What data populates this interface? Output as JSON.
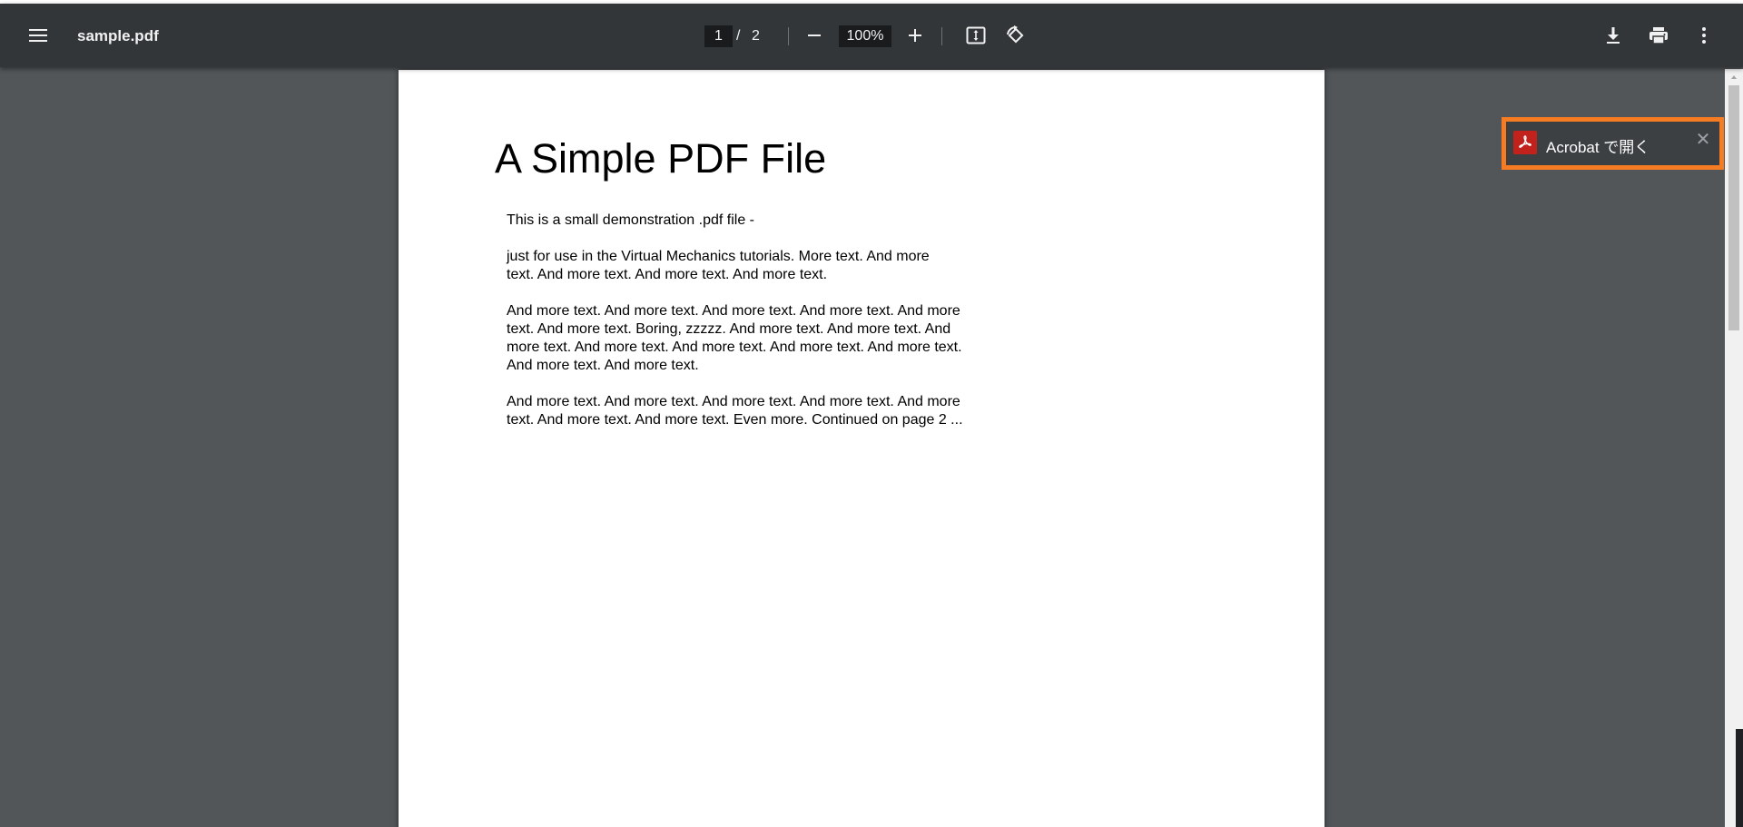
{
  "toolbar": {
    "title": "sample.pdf",
    "current_page": "1",
    "page_separator": "/",
    "total_pages": "2",
    "zoom": "100%"
  },
  "document": {
    "title": "A Simple PDF File",
    "paragraphs": [
      "This is a small demonstration .pdf file -",
      "just for use in the Virtual Mechanics tutorials. More text. And more\ntext. And more text. And more text. And more text.",
      "And more text. And more text. And more text. And more text. And more\ntext. And more text. Boring, zzzzz. And more text. And more text. And\nmore text. And more text. And more text. And more text. And more text.\nAnd more text. And more text.",
      "And more text. And more text. And more text. And more text. And more\ntext. And more text. And more text. Even more. Continued on page 2 ..."
    ]
  },
  "acrobat_banner": {
    "label": "Acrobat で開く",
    "close_symbol": "✕",
    "highlight_color": "#f57c22",
    "icon": "acrobat-icon"
  },
  "icons": {
    "menu": "menu-icon",
    "zoom_out": "minus-icon",
    "zoom_in": "plus-icon",
    "fit": "fit-to-page-icon",
    "rotate": "rotate-icon",
    "download": "download-icon",
    "print": "print-icon",
    "more": "more-vertical-icon"
  },
  "colors": {
    "toolbar_bg": "#323639",
    "viewer_bg": "#525659",
    "page_bg": "#ffffff"
  }
}
